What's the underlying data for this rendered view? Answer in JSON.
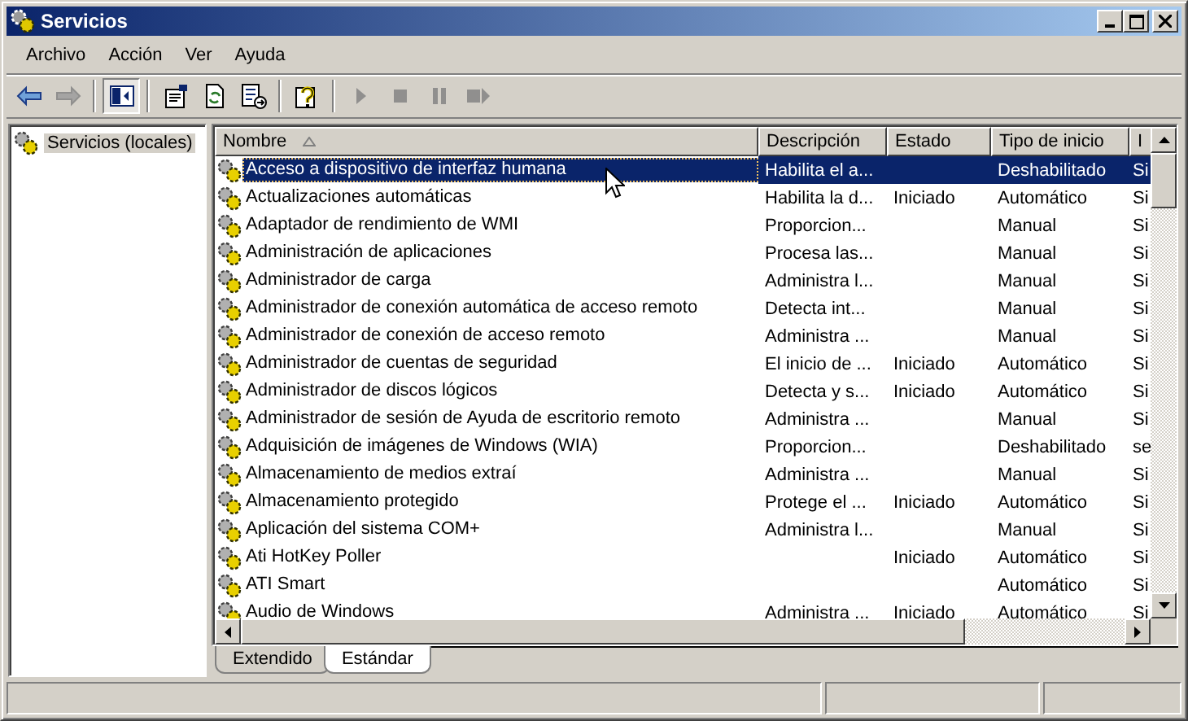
{
  "window": {
    "title": "Servicios"
  },
  "menu": [
    {
      "label": "Archivo"
    },
    {
      "label": "Acción"
    },
    {
      "label": "Ver"
    },
    {
      "label": "Ayuda"
    }
  ],
  "toolbar": [
    {
      "kind": "back",
      "disabled": false,
      "pressed": false
    },
    {
      "kind": "forward",
      "disabled": true,
      "pressed": false
    },
    {
      "kind": "separator"
    },
    {
      "kind": "tree",
      "disabled": false,
      "pressed": true
    },
    {
      "kind": "separator"
    },
    {
      "kind": "properties",
      "disabled": false,
      "pressed": false
    },
    {
      "kind": "refresh",
      "disabled": false,
      "pressed": false
    },
    {
      "kind": "export",
      "disabled": false,
      "pressed": false
    },
    {
      "kind": "separator"
    },
    {
      "kind": "help",
      "disabled": false,
      "pressed": false
    },
    {
      "kind": "separator"
    },
    {
      "kind": "play",
      "disabled": true,
      "pressed": false
    },
    {
      "kind": "stop",
      "disabled": true,
      "pressed": false
    },
    {
      "kind": "pause",
      "disabled": true,
      "pressed": false
    },
    {
      "kind": "restart",
      "disabled": true,
      "pressed": false
    }
  ],
  "tree": {
    "items": [
      {
        "label": "Servicios (locales)",
        "selected": true
      }
    ]
  },
  "table": {
    "columns": [
      {
        "label": "Nombre",
        "sorted": true
      },
      {
        "label": "Descripción",
        "sorted": false
      },
      {
        "label": "Estado",
        "sorted": false
      },
      {
        "label": "Tipo de inicio",
        "sorted": false
      },
      {
        "label": "I",
        "sorted": false
      }
    ],
    "rows": [
      {
        "name": "Acceso a dispositivo de interfaz humana",
        "description": "Habilita el a...",
        "status": "",
        "startup": "Deshabilitado",
        "column_5": "Si",
        "selected": true
      },
      {
        "name": "Actualizaciones automáticas",
        "description": "Habilita la d...",
        "status": "Iniciado",
        "startup": "Automático",
        "column_5": "Si",
        "selected": false
      },
      {
        "name": "Adaptador de rendimiento de WMI",
        "description": "Proporcion...",
        "status": "",
        "startup": "Manual",
        "column_5": "Si",
        "selected": false
      },
      {
        "name": "Administración de aplicaciones",
        "description": "Procesa las...",
        "status": "",
        "startup": "Manual",
        "column_5": "Si",
        "selected": false
      },
      {
        "name": "Administrador de carga",
        "description": "Administra l...",
        "status": "",
        "startup": "Manual",
        "column_5": "Si",
        "selected": false
      },
      {
        "name": "Administrador de conexión automática de acceso remoto",
        "description": "Detecta int...",
        "status": "",
        "startup": "Manual",
        "column_5": "Si",
        "selected": false
      },
      {
        "name": "Administrador de conexión de acceso remoto",
        "description": "Administra ...",
        "status": "",
        "startup": "Manual",
        "column_5": "Si",
        "selected": false
      },
      {
        "name": "Administrador de cuentas de seguridad",
        "description": "El inicio de ...",
        "status": "Iniciado",
        "startup": "Automático",
        "column_5": "Si",
        "selected": false
      },
      {
        "name": "Administrador de discos lógicos",
        "description": "Detecta y s...",
        "status": "Iniciado",
        "startup": "Automático",
        "column_5": "Si",
        "selected": false
      },
      {
        "name": "Administrador de sesión de Ayuda de escritorio remoto",
        "description": "Administra ...",
        "status": "",
        "startup": "Manual",
        "column_5": "Si",
        "selected": false
      },
      {
        "name": "Adquisición de imágenes de Windows (WIA)",
        "description": "Proporcion...",
        "status": "",
        "startup": "Deshabilitado",
        "column_5": "se",
        "selected": false
      },
      {
        "name": "Almacenamiento de medios extraí",
        "description": "Administra ...",
        "status": "",
        "startup": "Manual",
        "column_5": "Si",
        "selected": false
      },
      {
        "name": "Almacenamiento protegido",
        "description": "Protege el ...",
        "status": "Iniciado",
        "startup": "Automático",
        "column_5": "Si",
        "selected": false
      },
      {
        "name": "Aplicación del sistema COM+",
        "description": "Administra l...",
        "status": "",
        "startup": "Manual",
        "column_5": "Si",
        "selected": false
      },
      {
        "name": "Ati HotKey Poller",
        "description": "",
        "status": "Iniciado",
        "startup": "Automático",
        "column_5": "Si",
        "selected": false
      },
      {
        "name": "ATI Smart",
        "description": "",
        "status": "",
        "startup": "Automático",
        "column_5": "Si",
        "selected": false
      },
      {
        "name": "Audio de Windows",
        "description": "Administra ...",
        "status": "Iniciado",
        "startup": "Automático",
        "column_5": "Si",
        "selected": false
      }
    ]
  },
  "view_tabs": [
    {
      "label": "Extendido",
      "selected": false
    },
    {
      "label": "Estándar",
      "selected": true
    }
  ]
}
